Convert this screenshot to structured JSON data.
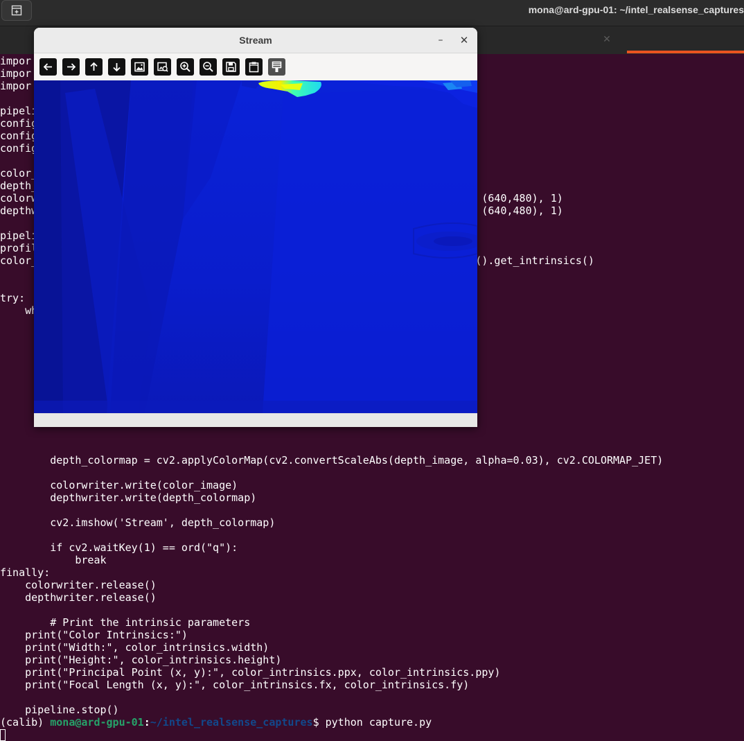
{
  "terminal": {
    "title": "mona@ard-gpu-01: ~/intel_realsense_captures",
    "lines": [
      "impor",
      "impor",
      "impor",
      "",
      "pipeli",
      "config",
      "config",
      "config",
      "",
      "color_",
      "depth_",
      "colorw                                                                    ), (640,480), 1)",
      "depthw                                                                    ), (640,480), 1)",
      "",
      "pipeli",
      "profil",
      "color_                                                                     e().get_intrinsics()",
      "",
      "",
      "try:",
      "    wh",
      "",
      "",
      "",
      "",
      "",
      "",
      "",
      "",
      "",
      "",
      "",
      "        depth_colormap = cv2.applyColorMap(cv2.convertScaleAbs(depth_image, alpha=0.03), cv2.COLORMAP_JET)",
      "",
      "        colorwriter.write(color_image)",
      "        depthwriter.write(depth_colormap)",
      "",
      "        cv2.imshow('Stream', depth_colormap)",
      "",
      "        if cv2.waitKey(1) == ord(\"q\"):",
      "            break",
      "finally:",
      "    colorwriter.release()",
      "    depthwriter.release()",
      "",
      "        # Print the intrinsic parameters",
      "    print(\"Color Intrinsics:\")",
      "    print(\"Width:\", color_intrinsics.width)",
      "    print(\"Height:\", color_intrinsics.height)",
      "    print(\"Principal Point (x, y):\", color_intrinsics.ppx, color_intrinsics.ppy)",
      "    print(\"Focal Length (x, y):\", color_intrinsics.fx, color_intrinsics.fy)",
      "",
      "    pipeline.stop()"
    ],
    "prompt": {
      "env": "(calib) ",
      "user_host": "mona@ard-gpu-01",
      "colon": ":",
      "path": "~/intel_realsense_captures",
      "symbol": "$ ",
      "command": "python capture.py"
    }
  },
  "stream_window": {
    "title": "Stream",
    "minimize_glyph": "–",
    "close_glyph": "✕",
    "toolbar": [
      {
        "icon": "arrow-left-icon"
      },
      {
        "icon": "arrow-right-icon"
      },
      {
        "icon": "arrow-up-icon"
      },
      {
        "icon": "arrow-down-icon"
      },
      {
        "icon": "image-icon"
      },
      {
        "icon": "image-search-icon"
      },
      {
        "icon": "zoom-in-icon"
      },
      {
        "icon": "zoom-out-icon"
      },
      {
        "icon": "save-icon"
      },
      {
        "icon": "clipboard-icon"
      },
      {
        "icon": "properties-icon"
      }
    ]
  },
  "colors": {
    "terminal_bg": "#380c2a",
    "prompt_user": "#26a269",
    "prompt_path": "#12488b",
    "accent": "#e95420",
    "depth_base": "#0b1ed3"
  }
}
